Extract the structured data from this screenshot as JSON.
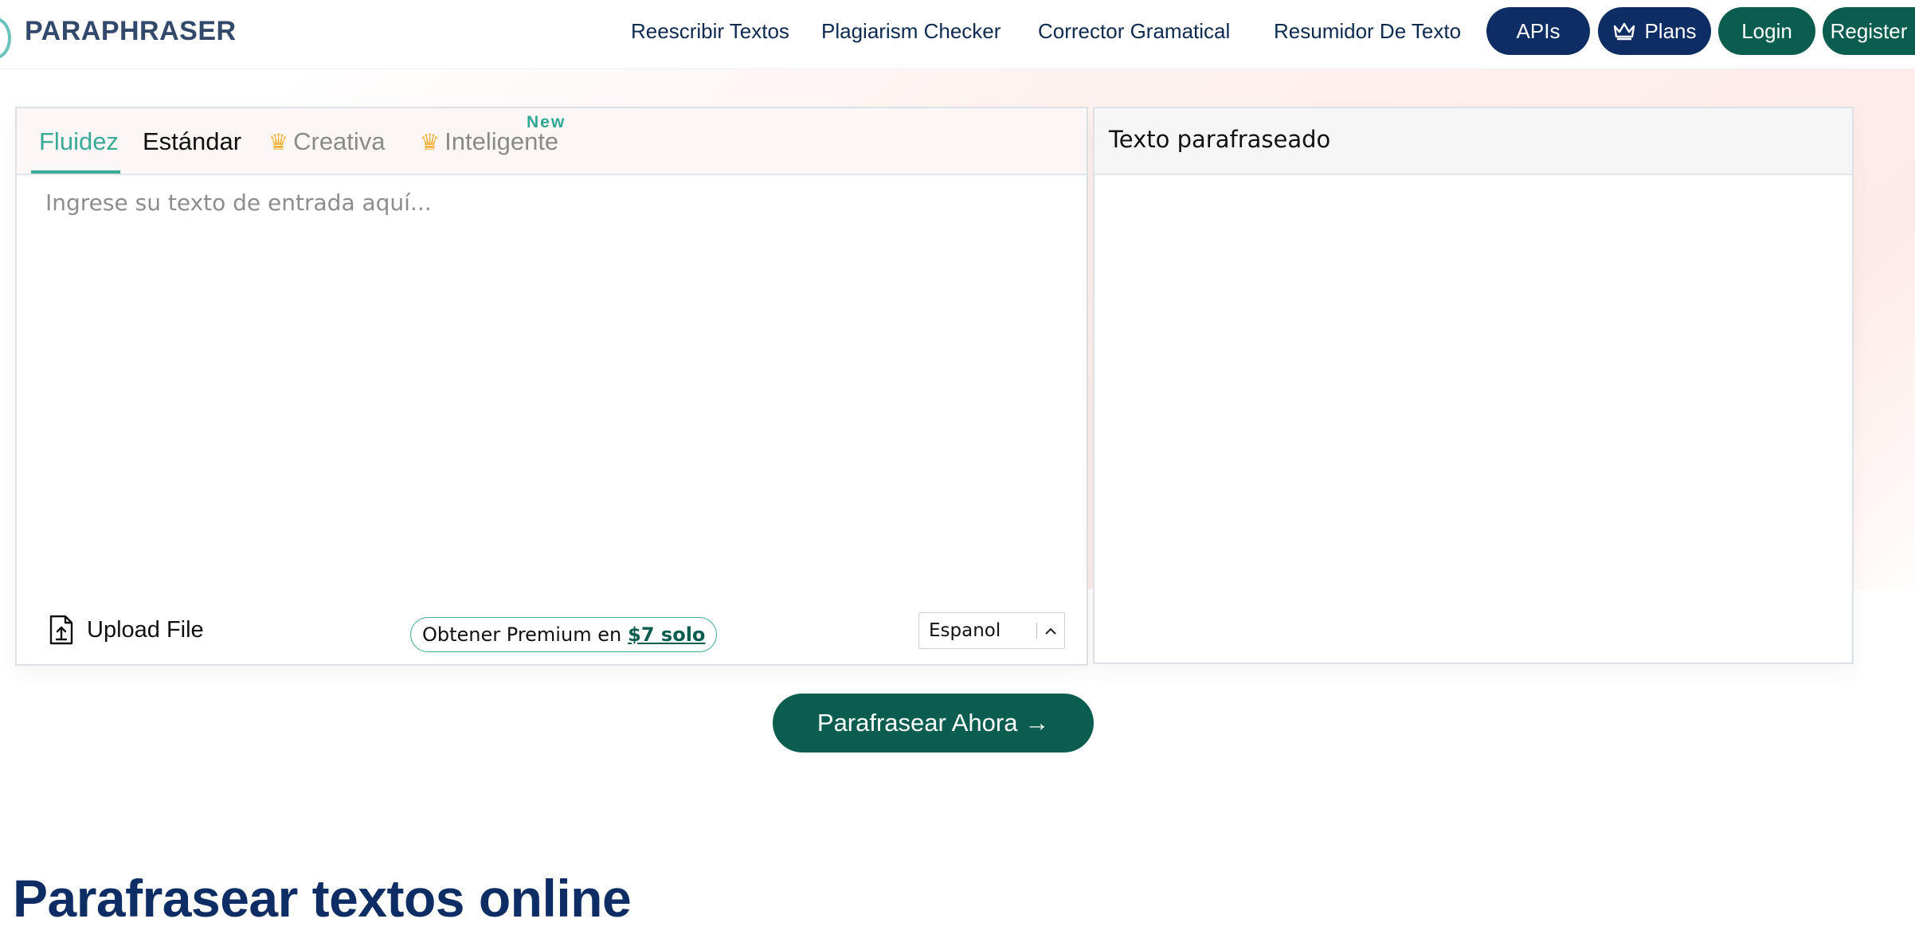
{
  "header": {
    "logo": "PARAPHRASER",
    "nav": [
      "Reescribir Textos",
      "Plagiarism Checker",
      "Corrector Gramatical",
      "Resumidor De Texto"
    ],
    "apis_label": "APIs",
    "plans_label": "Plans",
    "login_label": "Login",
    "register_label": "Register"
  },
  "editor": {
    "tabs": {
      "fluidez": "Fluidez",
      "estandar": "Estándar",
      "creativa": "Creativa",
      "inteligente": "Inteligente",
      "new_badge": "New"
    },
    "placeholder": "Ingrese su texto de entrada aquí...",
    "upload_label": "Upload File",
    "premium_text": "Obtener Premium en",
    "premium_price": "$7 solo",
    "language": "Espanol"
  },
  "output": {
    "title": "Texto parafraseado"
  },
  "cta_label": "Parafrasear Ahora →",
  "heading": "Parafrasear textos online",
  "colors": {
    "brand_navy": "#0d2d64",
    "brand_green": "#0b5e4f",
    "accent_teal": "#3aa995",
    "crown_gold": "#f2b441"
  },
  "icons": {
    "plans": "crown-icon",
    "upload": "file-upload-icon",
    "language": "chevron-up-icon"
  }
}
